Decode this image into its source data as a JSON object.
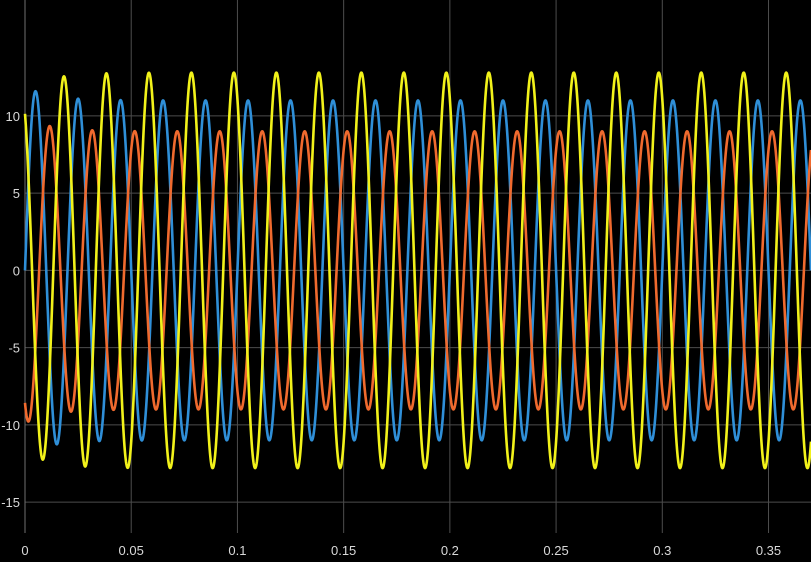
{
  "chart_data": {
    "type": "line",
    "title": "",
    "xlabel": "",
    "ylabel": "",
    "xlim": [
      0,
      0.37
    ],
    "ylim": [
      -17,
      17.5
    ],
    "grid": true,
    "background": "#000000",
    "grid_color": "#4d4d4d",
    "x_ticks": [
      0,
      0.05,
      0.1,
      0.15,
      0.2,
      0.25,
      0.3,
      0.35
    ],
    "x_tick_labels": [
      "0",
      "0.05",
      "0.1",
      "0.15",
      "0.2",
      "0.25",
      "0.3",
      "0.35"
    ],
    "y_ticks": [
      -15,
      -10,
      -5,
      0,
      5,
      10
    ],
    "y_tick_labels": [
      "-15",
      "-10",
      "-5",
      "0",
      "5",
      "10"
    ],
    "series": [
      {
        "color": "#0072bd",
        "line_color": "#2f8fd8",
        "amplitude": 11,
        "frequency_hz": 50,
        "phase_deg": 0,
        "offset": 0,
        "transient": "peaks near 11.9 at t≈0.007, settles to about ±11"
      },
      {
        "color": "#d95319",
        "line_color": "#f06a2e",
        "amplitude": 9,
        "frequency_hz": 50,
        "phase_deg": -120,
        "offset": 0,
        "transient": "dips to about -9.3 near t≈0.002"
      },
      {
        "color": "#edb120",
        "line_color": "#f2f21a",
        "amplitude": 12.8,
        "frequency_hz": 50,
        "phase_deg": 120,
        "offset": 0,
        "transient": "starts near 12, dips to about -13.5 near t≈0.011"
      }
    ]
  }
}
